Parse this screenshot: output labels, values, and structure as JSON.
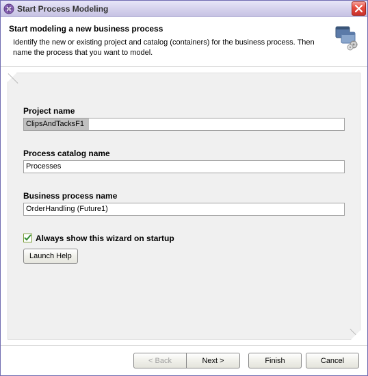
{
  "window": {
    "title": "Start Process Modeling"
  },
  "header": {
    "title": "Start modeling a new business process",
    "description": "Identify the new or existing project and catalog (containers) for the business process. Then name the process that you want to model."
  },
  "fields": {
    "project": {
      "label": "Project name",
      "value": "ClipsAndTacksF1"
    },
    "catalog": {
      "label": "Process catalog name",
      "value": "Processes"
    },
    "process": {
      "label": "Business process name",
      "value": "OrderHandling (Future1)"
    }
  },
  "options": {
    "always_show_label": "Always show this wizard on startup",
    "always_show_checked": true,
    "launch_help_label": "Launch Help"
  },
  "buttons": {
    "back": "< Back",
    "next": "Next >",
    "finish": "Finish",
    "cancel": "Cancel"
  }
}
